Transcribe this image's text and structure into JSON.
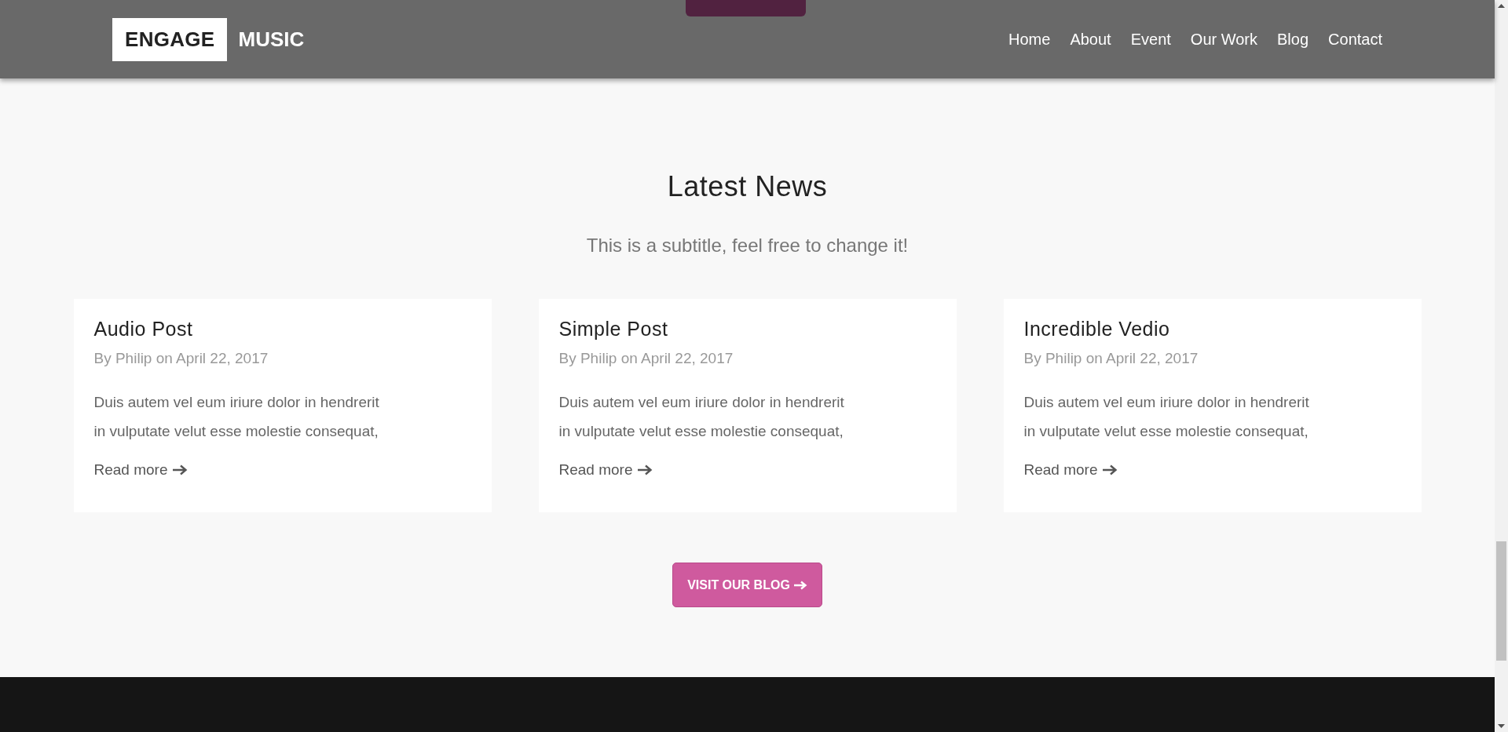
{
  "header": {
    "logo": {
      "first": "ENGAGE",
      "second": "MUSIC"
    },
    "nav": [
      "Home",
      "About",
      "Event",
      "Our Work",
      "Blog",
      "Contact"
    ]
  },
  "section": {
    "title": "Latest News",
    "subtitle": "This is a subtitle, feel free to change it!"
  },
  "posts": [
    {
      "title": "Audio Post",
      "meta": "By Philip on April 22, 2017",
      "lines": [
        "Duis autem vel eum iriure dolor in hendrerit",
        "in vulputate velut esse molestie consequat,"
      ],
      "link": "Read more"
    },
    {
      "title": "Simple Post",
      "meta": "By Philip on April 22, 2017",
      "lines": [
        "Duis autem vel eum iriure dolor in hendrerit",
        "in vulputate velut esse molestie consequat,"
      ],
      "link": "Read more"
    },
    {
      "title": "Incredible Vedio",
      "meta": "By Philip on April 22, 2017",
      "lines": [
        "Duis autem vel eum iriure dolor in hendrerit",
        "in vulputate velut esse molestie consequat,"
      ],
      "link": "Read more"
    }
  ],
  "cta": {
    "label": "VISIT OUR BLOG"
  }
}
